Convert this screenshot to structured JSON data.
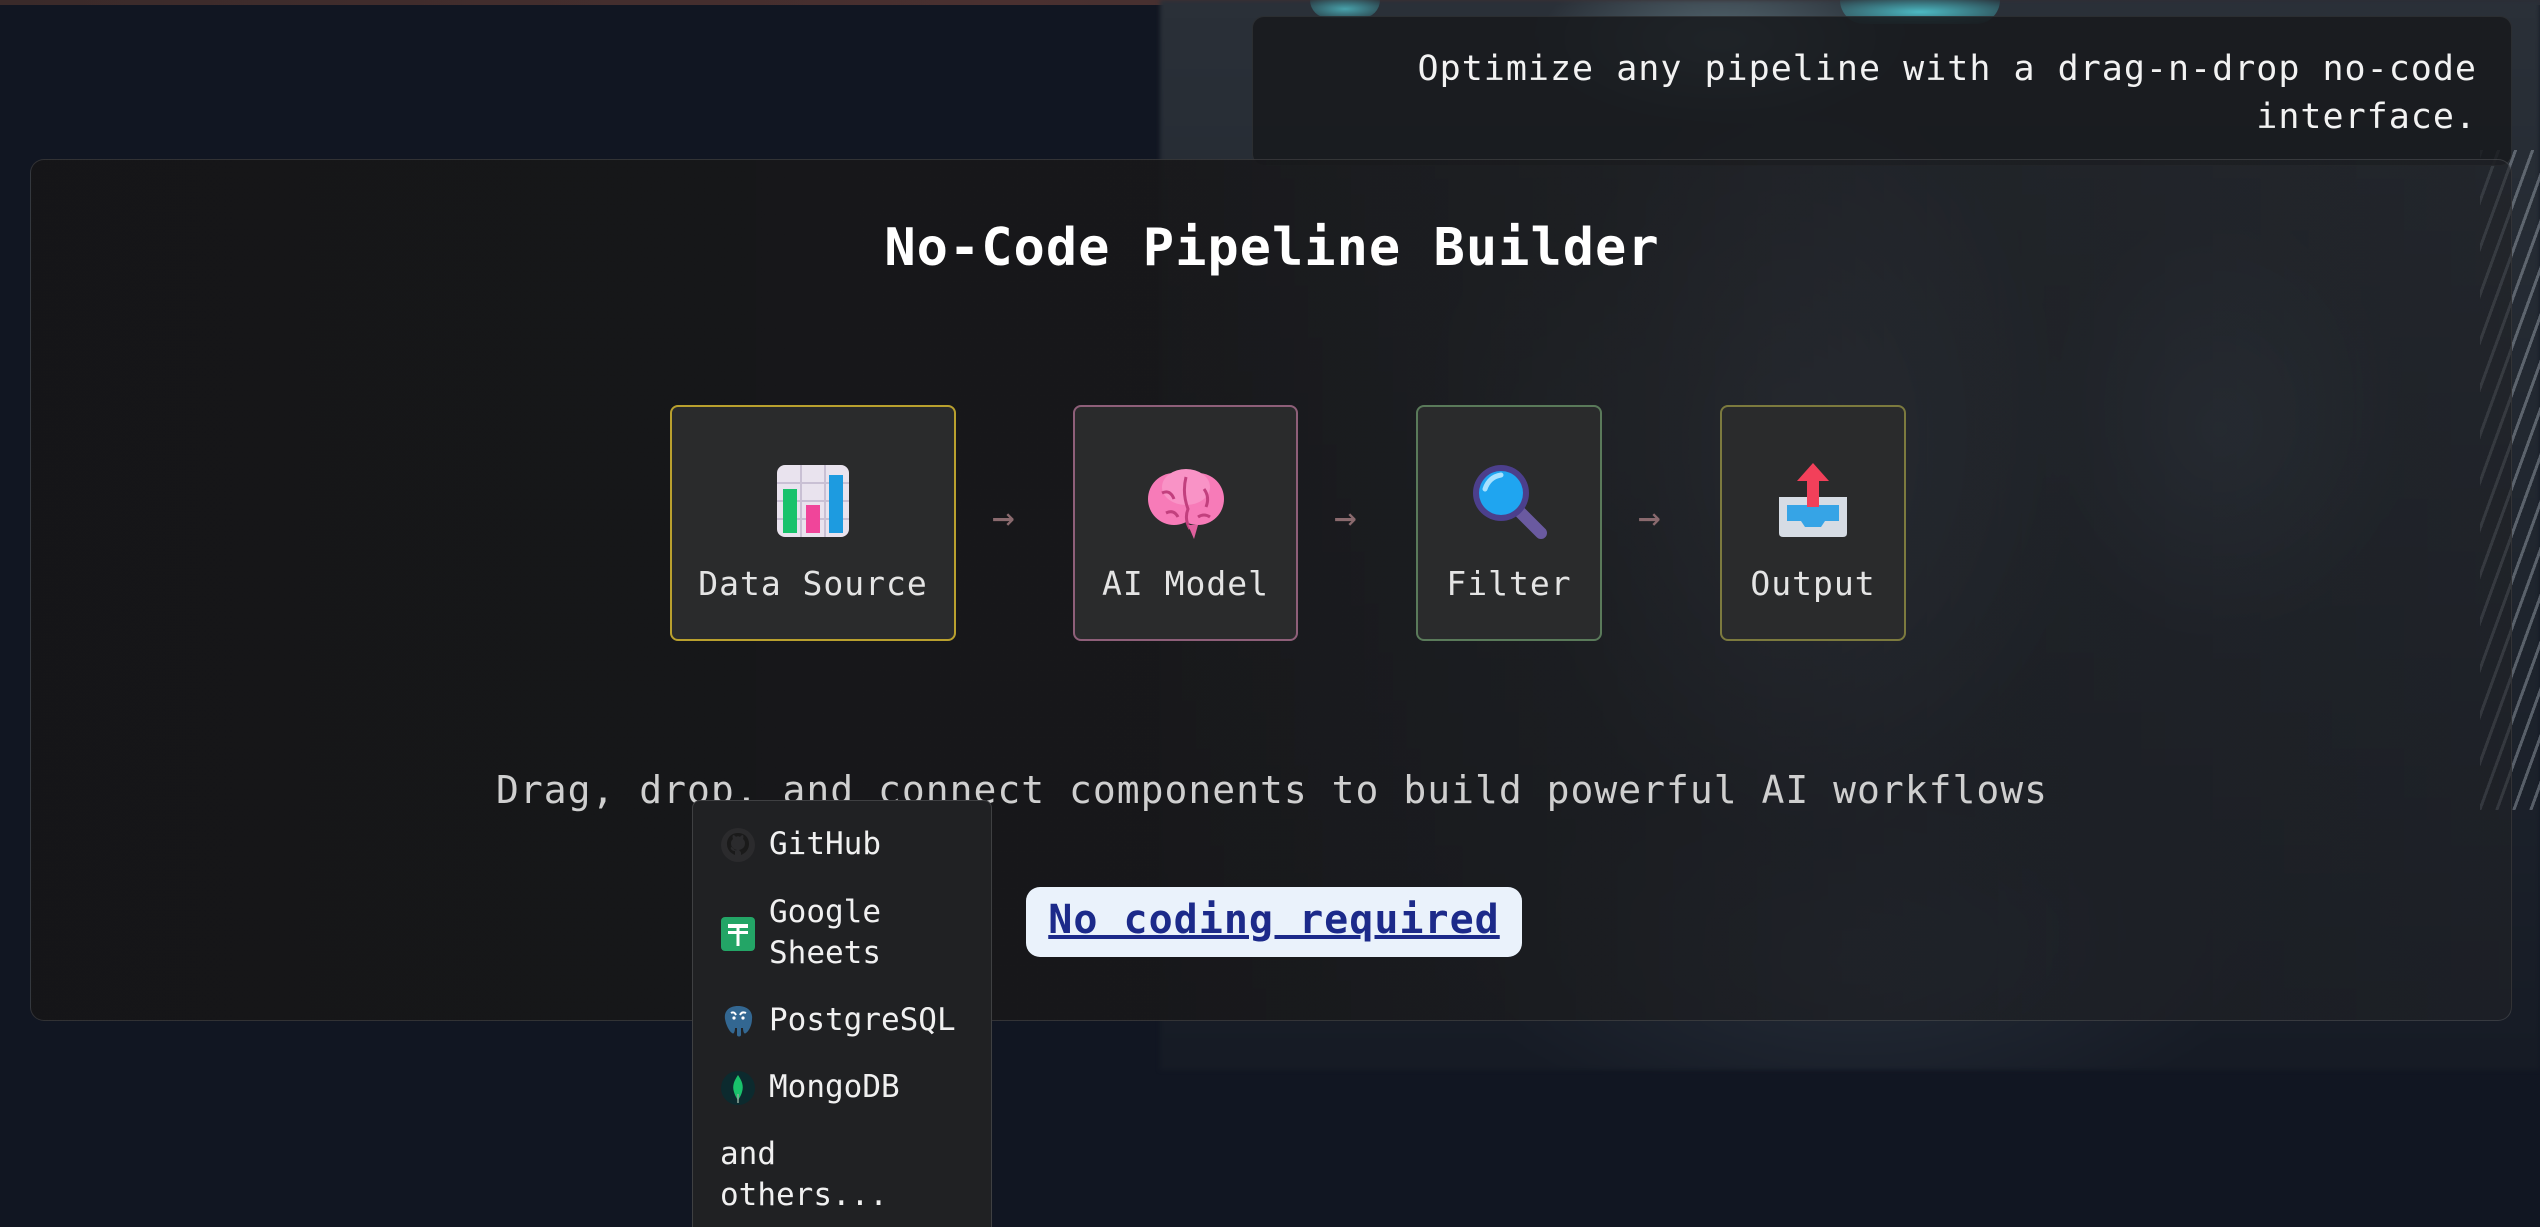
{
  "tagline": "Optimize any pipeline with a drag-n-drop no-code interface.",
  "builder": {
    "title": "No-Code Pipeline Builder",
    "nodes": [
      {
        "label": "Data Source",
        "icon": "bar-chart-icon"
      },
      {
        "label": "AI Model",
        "icon": "brain-icon"
      },
      {
        "label": "Filter",
        "icon": "magnifier-icon"
      },
      {
        "label": "Output",
        "icon": "outbox-tray-icon"
      }
    ],
    "arrow": "→",
    "subtitle": "Drag, drop, and connect components to build powerful AI workflows",
    "badge": "No coding required"
  },
  "dropdown": {
    "items": [
      {
        "label": "GitHub",
        "icon": "github-icon"
      },
      {
        "label": "Google Sheets",
        "icon": "google-sheets-icon"
      },
      {
        "label": "PostgreSQL",
        "icon": "postgresql-icon"
      },
      {
        "label": "MongoDB",
        "icon": "mongodb-icon"
      }
    ],
    "more": "and others..."
  },
  "colors": {
    "background": "#111622",
    "panel": "#18181a",
    "badge_bg": "#eaf2fb",
    "badge_text": "#1c2a8a",
    "source_border": "#b9a02e",
    "model_border": "#8e5f79",
    "filter_border": "#5a7a5a",
    "output_border": "#7c7a3e"
  }
}
